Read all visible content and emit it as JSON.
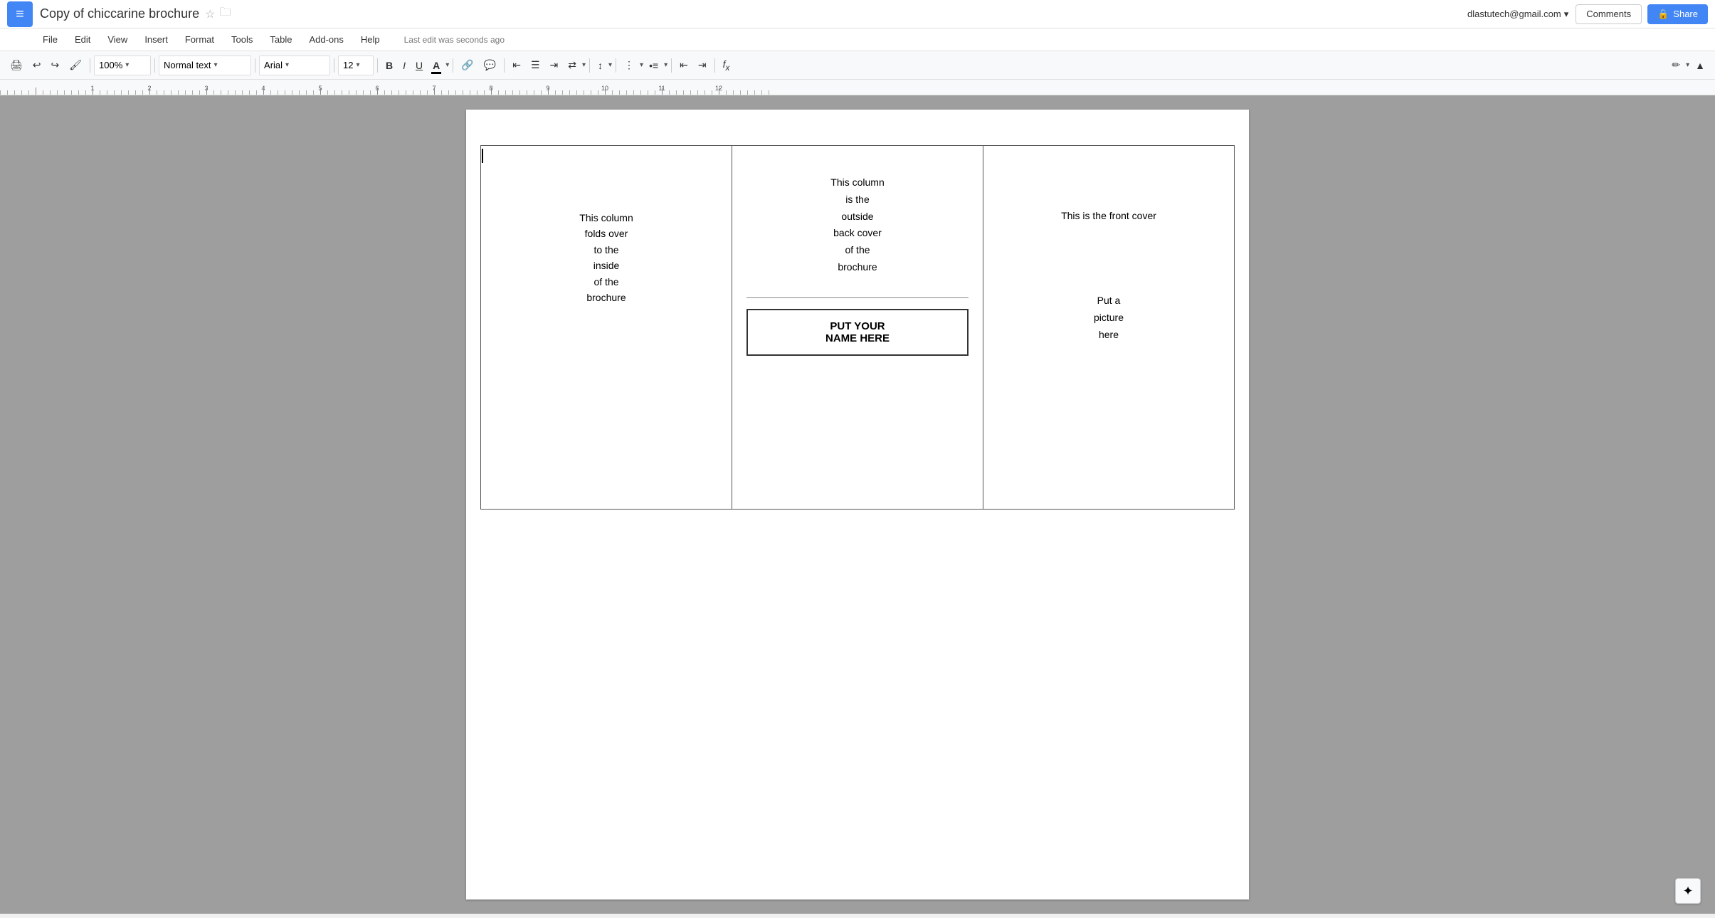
{
  "app": {
    "icon": "≡",
    "doc_title": "Copy of chiccarine brochure",
    "star_label": "☆",
    "folder_label": "🗀"
  },
  "header": {
    "user_email": "dlastutech@gmail.com",
    "dropdown_arrow": "▾",
    "comments_label": "Comments",
    "share_label": "Share",
    "share_icon": "🔒"
  },
  "menu": {
    "items": [
      "File",
      "Edit",
      "View",
      "Insert",
      "Format",
      "Tools",
      "Table",
      "Add-ons",
      "Help"
    ],
    "last_edit": "Last edit was seconds ago"
  },
  "toolbar": {
    "zoom": "100%",
    "style": "Normal text",
    "font": "Arial",
    "size": "12",
    "bold": "B",
    "italic": "I",
    "underline": "U",
    "text_color": "A",
    "link": "🔗",
    "comment": "💬",
    "align_left": "≡",
    "align_center": "≡",
    "align_right": "≡",
    "align_justify": "≡",
    "line_spacing": "≡",
    "list_ordered": "≡",
    "list_unordered": "≡",
    "indent_less": "⇤",
    "indent_more": "⇥",
    "formula": "fx"
  },
  "document": {
    "col1_text": "This column\nfolds over\nto the\ninside\nof the\nbrochure",
    "col2_text": "This column\nis the\noutside\nback cover\nof the\nbrochure",
    "name_box_text": "PUT YOUR\nNAME HERE",
    "col3_title": "This is the front cover",
    "col3_picture": "Put a\npicture\nhere"
  },
  "smart_compose": {
    "icon": "✦"
  }
}
